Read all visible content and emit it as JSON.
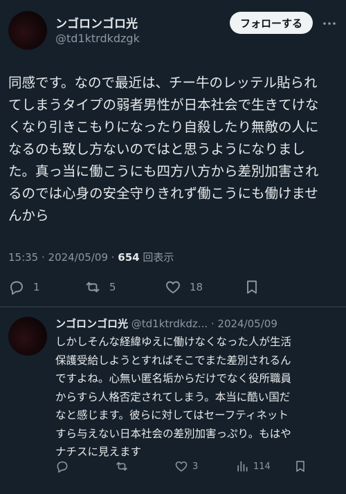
{
  "colors": {
    "background": "#15202b",
    "text_primary": "#e7e9ea",
    "text_secondary": "#8b98a5",
    "divider": "#38444d",
    "follow_bg": "#eff3f4"
  },
  "main_tweet": {
    "display_name": "ンゴロンゴロ光",
    "handle": "@td1ktrdkdzgk",
    "follow_label": "フォローする",
    "body": "同感です。なので最近は、チー牛のレッテル貼られ\nてしまうタイプの弱者男性が日本社会で生きてけな\nくなり引きこもりになったり自殺したり無敵の人に\nなるのも致し方ないのではと思うようになりまし\nた。真っ当に働こうにも四方八方から差別加害され\nるのでは心身の安全守りきれず働こうにも働けませ\nんから",
    "time": "15:35 · 2024/05/09 · ",
    "views_count": "654",
    "views_label": " 回表示",
    "actions": {
      "reply_count": "1",
      "retweet_count": "5",
      "like_count": "18"
    }
  },
  "reply_tweet": {
    "display_name": "ンゴロンゴロ光",
    "handle": " @td1ktrdkdz...",
    "date": " · 2024/05/09",
    "body": "しかしそんな経緯ゆえに働けなくなった人が生活\n保護受給しようとすればそこでまた差別されるん\nですよね。心無い匿名垢からだけでなく役所職員\nからすら人格否定されてしまう。本当に酷い国だ\nなと感じます。彼らに対してはセーフティネット\nすら与えない日本社会の差別加害っぷり。もはや\nナチスに見えます",
    "actions": {
      "reply_count": "",
      "retweet_count": "",
      "like_count": "3",
      "views_count": "114"
    }
  },
  "icons": {
    "more": "more-dots-icon",
    "reply": "reply-bubble-icon",
    "retweet": "retweet-icon",
    "like": "heart-icon",
    "bookmark": "bookmark-icon",
    "views": "analytics-bars-icon"
  }
}
